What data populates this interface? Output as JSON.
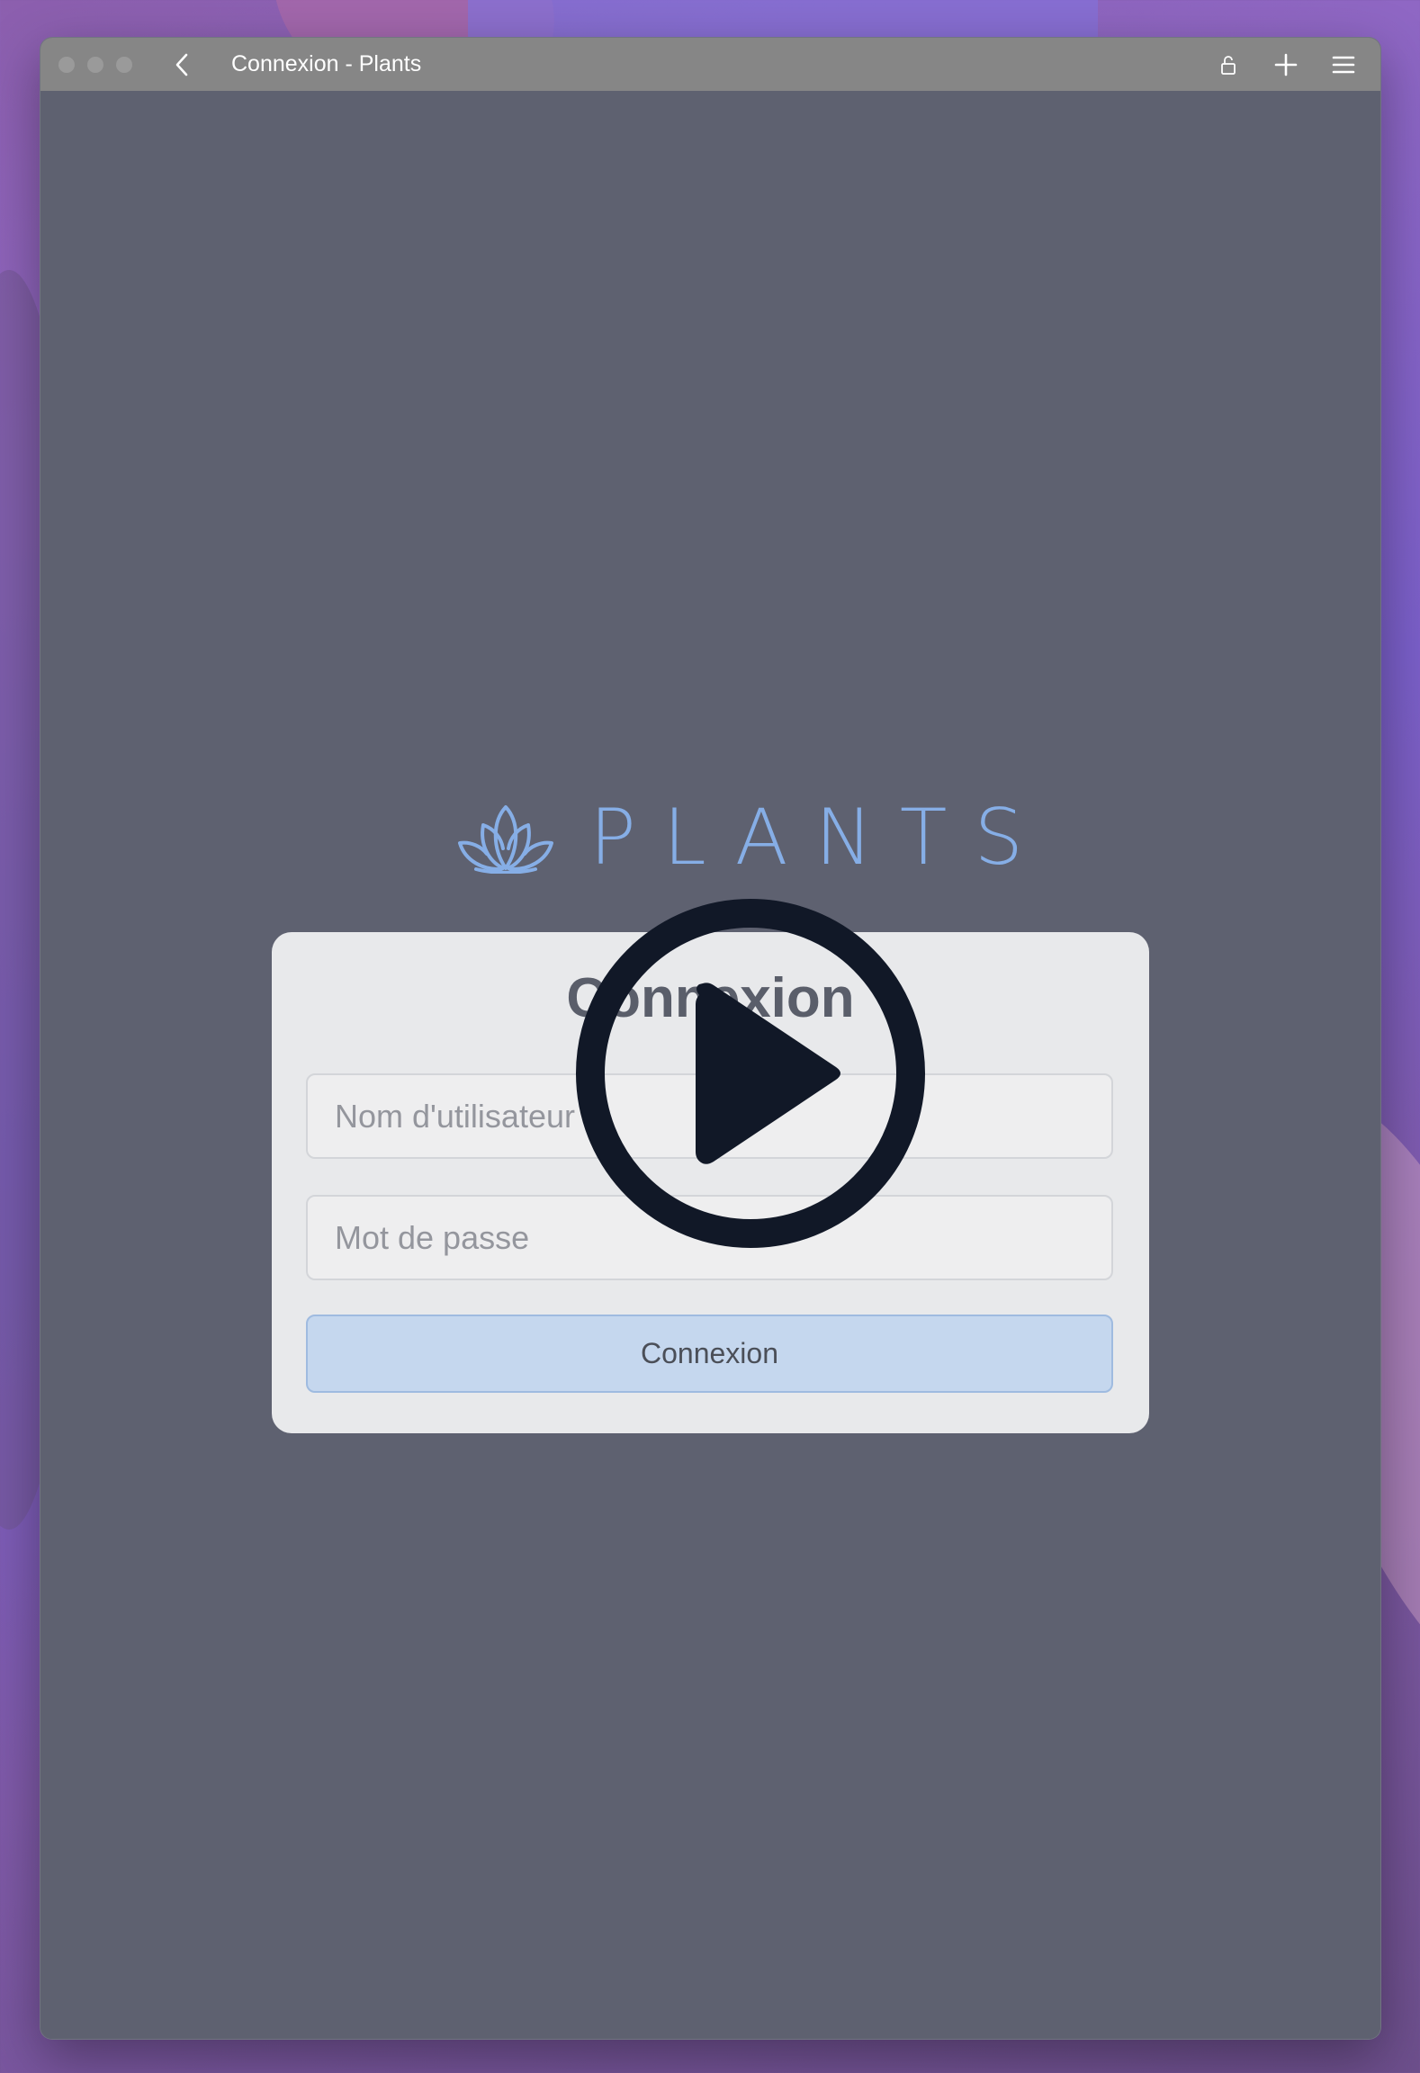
{
  "window": {
    "title": "Connexion - Plants"
  },
  "icons": {
    "back": "chevron-left-icon",
    "lock": "lock-icon",
    "new_tab": "plus-icon",
    "menu": "hamburger-menu-icon",
    "logo": "lotus-icon",
    "play": "play-icon"
  },
  "logo": {
    "text": "PLANTS"
  },
  "login": {
    "title": "Connexion",
    "username_placeholder": "Nom d'utilisateur",
    "password_placeholder": "Mot de passe",
    "submit_label": "Connexion"
  },
  "colors": {
    "accent": "#86aee6",
    "button_bg": "#c5d7ee",
    "overlay_dark": "#111827"
  }
}
